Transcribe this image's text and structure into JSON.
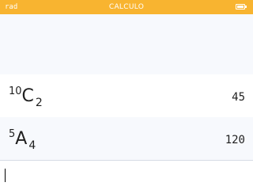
{
  "status_bar": {
    "angle_mode": "rad",
    "title": "CALCULO",
    "battery_icon": "battery-full-icon",
    "color": "#f8b430"
  },
  "history": [
    {
      "expression": {
        "superscript": "10",
        "function": "C",
        "subscript": "2"
      },
      "result": "45"
    },
    {
      "expression": {
        "superscript": "5",
        "function": "A",
        "subscript": "4"
      },
      "result": "120"
    }
  ],
  "input": {
    "value": ""
  }
}
